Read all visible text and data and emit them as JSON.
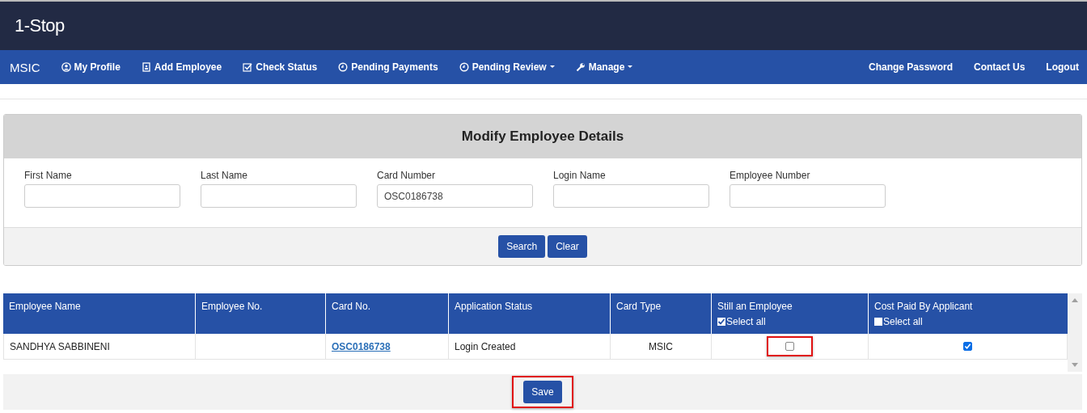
{
  "brand": {
    "logo": "1-Stop"
  },
  "nav": {
    "left": [
      {
        "label": "MSIC",
        "kind": "brand"
      },
      {
        "label": "My Profile",
        "kind": "profile"
      },
      {
        "label": "Add Employee",
        "kind": "add"
      },
      {
        "label": "Check Status",
        "kind": "status"
      },
      {
        "label": "Pending Payments",
        "kind": "pending"
      },
      {
        "label": "Pending Review",
        "kind": "pending",
        "dropdown": true
      },
      {
        "label": "Manage",
        "kind": "manage",
        "dropdown": true
      }
    ],
    "right": [
      "Change Password",
      "Contact Us",
      "Logout"
    ]
  },
  "search_panel": {
    "title": "Modify Employee Details",
    "fields": [
      {
        "label": "First Name"
      },
      {
        "label": "Last Name"
      },
      {
        "label": "Card Number",
        "value": "OSC0186738"
      },
      {
        "label": "Login Name"
      },
      {
        "label": "Employee Number"
      }
    ],
    "buttons": [
      "Search",
      "Clear"
    ]
  },
  "table": {
    "columns": [
      {
        "label": "Employee Name"
      },
      {
        "label": "Employee No."
      },
      {
        "label": "Card No."
      },
      {
        "label": "Application Status"
      },
      {
        "label": "Card Type"
      },
      {
        "label": "Still an Employee",
        "select_all": {
          "label": "Select all",
          "checked": true
        }
      },
      {
        "label": "Cost Paid By Applicant",
        "select_all": {
          "label": "Select all",
          "checked": false
        }
      }
    ],
    "rows": [
      {
        "employee_name": "SANDHYA SABBINENI",
        "card_no": "OSC0186738",
        "application_status": "Login Created",
        "card_type": "MSIC",
        "still_employee": {
          "checked": false,
          "highlighted": true
        },
        "cost_paid": {
          "checked": true,
          "highlighted": false
        }
      }
    ]
  },
  "save_button": {
    "label": "Save",
    "highlighted": true
  }
}
